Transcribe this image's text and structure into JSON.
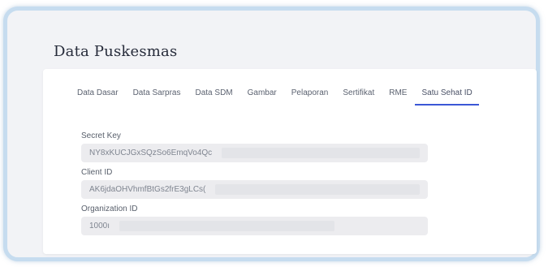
{
  "page": {
    "title": "Data Puskesmas"
  },
  "tabs": [
    {
      "label": "Data Dasar",
      "active": false
    },
    {
      "label": "Data Sarpras",
      "active": false
    },
    {
      "label": "Data SDM",
      "active": false
    },
    {
      "label": "Gambar",
      "active": false
    },
    {
      "label": "Pelaporan",
      "active": false
    },
    {
      "label": "Sertifikat",
      "active": false
    },
    {
      "label": "RME",
      "active": false
    },
    {
      "label": "Satu Sehat ID",
      "active": true
    }
  ],
  "fields": {
    "secret_key": {
      "label": "Secret Key",
      "value": "NY8xKUCJGxSQzSo6EmqVo4Qc"
    },
    "client_id": {
      "label": "Client ID",
      "value": "AK6jdaOHVhmfBtGs2frE3gLCs("
    },
    "organization_id": {
      "label": "Organization ID",
      "value": "1000ı"
    }
  },
  "colors": {
    "accent": "#3b57d6",
    "frame_border": "#c6dcef",
    "input_bg": "#ececef"
  }
}
